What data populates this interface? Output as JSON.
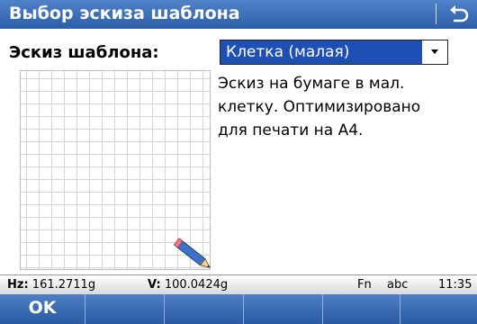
{
  "window": {
    "title": "Выбор эскиза шаблона",
    "back_icon": "back-arrow-icon"
  },
  "form": {
    "template_label": "Эскиз шаблона:",
    "template_value": "Клетка (малая)",
    "description": "Эскиз на бумаге в мал.\nклетку. Оптимизировано\nдля печати на А4."
  },
  "status": {
    "hz_label": "Hz:",
    "hz_value": "161.2711g",
    "v_label": "V:",
    "v_value": "100.0424g",
    "fn": "Fn",
    "input_mode": "abc",
    "time": "11:35"
  },
  "softkeys": [
    "OK",
    "",
    "",
    "",
    "",
    ""
  ],
  "colors": {
    "title_bar": "#3a6cb5",
    "selection": "#1d4fb5",
    "grid": "#d4d4d4"
  }
}
